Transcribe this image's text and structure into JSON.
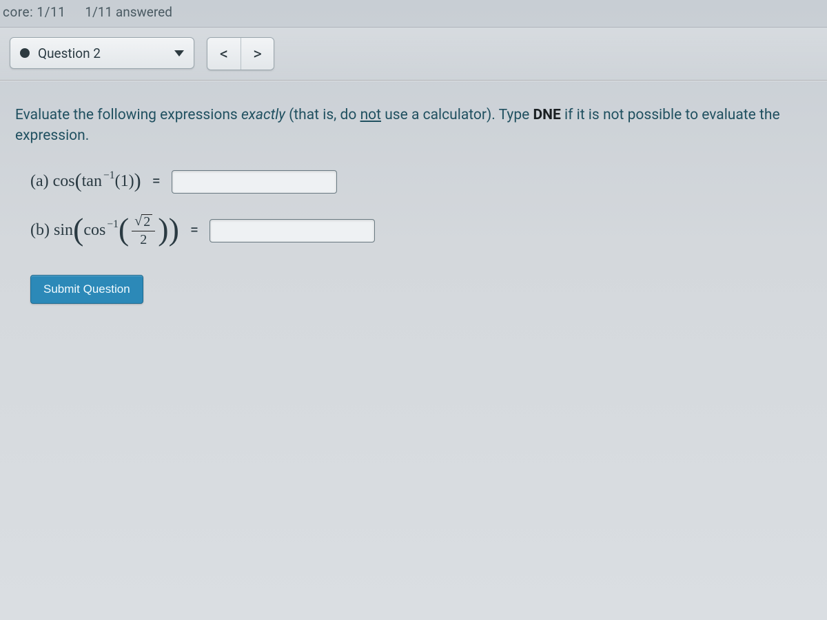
{
  "topbar": {
    "score_label": "core: 1/11",
    "answered_label": "1/11 answered"
  },
  "controls": {
    "question_label": "Question 2",
    "prev_glyph": "<",
    "next_glyph": ">"
  },
  "instructions": {
    "pre": "Evaluate the following expressions ",
    "italic": "exactly",
    "mid": " (that is, do ",
    "underline": "not",
    "post_underline": " use a calculator). Type ",
    "bold": "DNE",
    "tail": " if it is not possible to evaluate the expression."
  },
  "parts": {
    "a": {
      "label": "(a)",
      "fn_outer": "cos",
      "fn_inner": "tan",
      "exp": "−1",
      "arg": "1",
      "equals": "="
    },
    "b": {
      "label": "(b)",
      "fn_outer": "sin",
      "fn_inner": "cos",
      "exp": "−1",
      "frac_num_rad": "2",
      "frac_den": "2",
      "equals": "="
    }
  },
  "buttons": {
    "submit": "Submit Question"
  }
}
